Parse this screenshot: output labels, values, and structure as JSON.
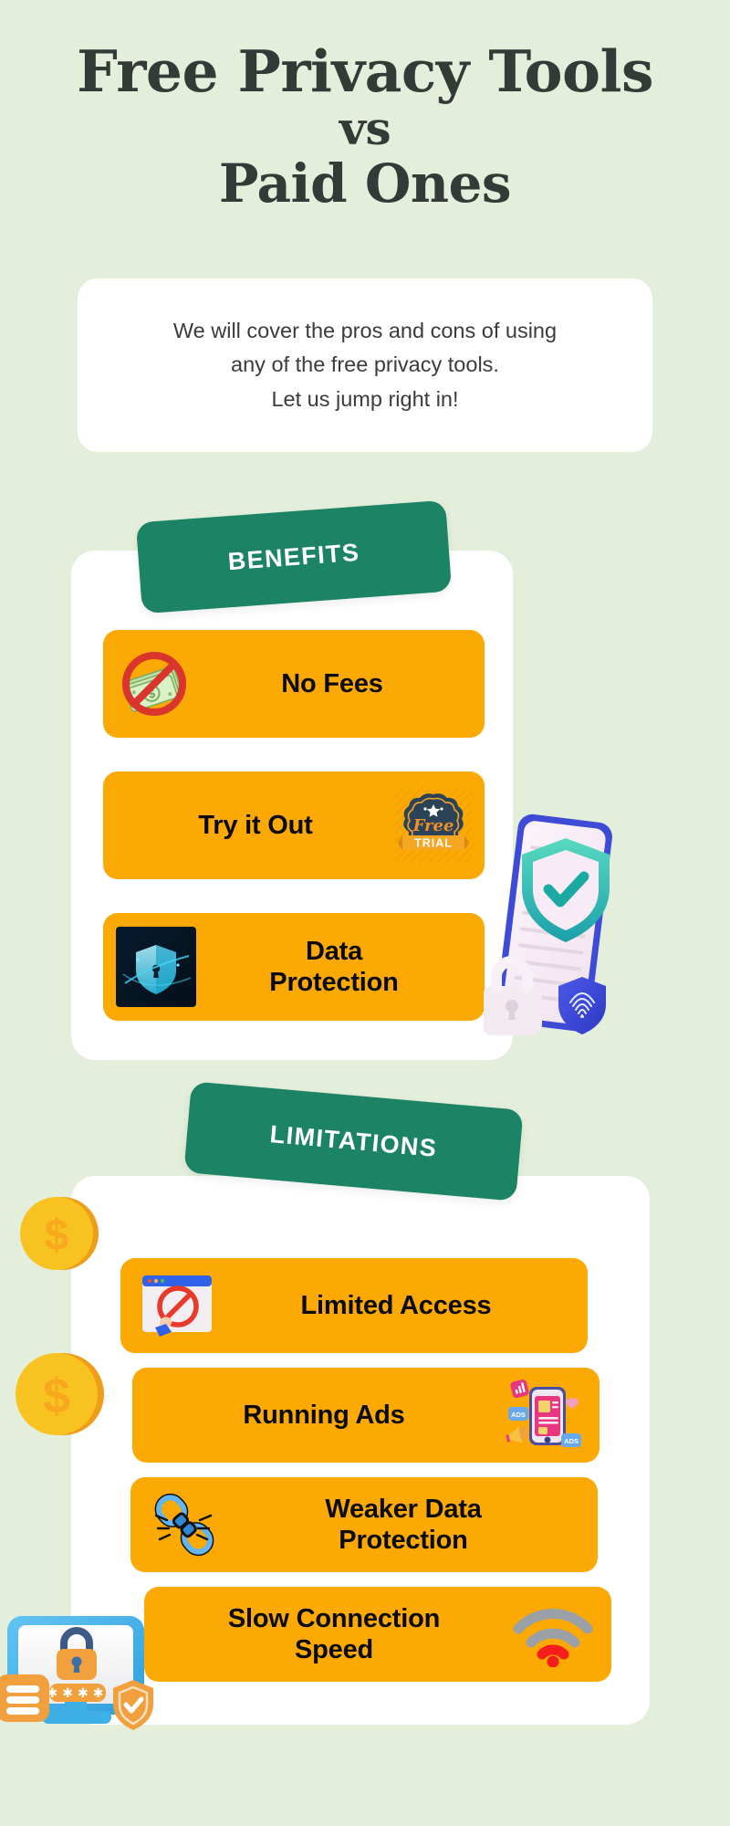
{
  "theme": {
    "background": "#e3eedb",
    "card": "#ffffff",
    "accent_green": "#1c8464",
    "accent_orange": "#fca903",
    "title_color": "#343a36",
    "body_text": "#3b3b3b",
    "row_text": "#0a0a0a",
    "coin_gold": "#f7c225",
    "coin_gold_dark": "#f29d18"
  },
  "title": {
    "line1": "Free Privacy Tools",
    "line2": "vs",
    "line3": "Paid Ones"
  },
  "intro": {
    "line1": "We will cover the pros and cons of using",
    "line2": "any of the free privacy tools.",
    "line3": "Let us jump right in!"
  },
  "sections": [
    {
      "badge_label": "BENEFITS",
      "items": [
        {
          "label": "No Fees",
          "icon": "no-money-icon",
          "icon_side": "left"
        },
        {
          "label": "Try it Out",
          "icon": "free-trial-badge-icon",
          "icon_side": "right"
        },
        {
          "label": "Data\nProtection",
          "label_line1": "Data",
          "label_line2": "Protection",
          "icon": "shield-keyhole-icon",
          "icon_side": "left"
        }
      ]
    },
    {
      "badge_label": "LIMITATIONS",
      "items": [
        {
          "label": "Limited Access",
          "icon": "browser-blocked-icon",
          "icon_side": "left"
        },
        {
          "label": "Running Ads",
          "icon": "phone-ads-icon",
          "icon_side": "right"
        },
        {
          "label_line1": "Weaker Data",
          "label_line2": "Protection",
          "icon": "broken-chain-icon",
          "icon_side": "left"
        },
        {
          "label_line1": "Slow Connection",
          "label_line2": "Speed",
          "icon": "weak-wifi-icon",
          "icon_side": "right"
        }
      ]
    }
  ],
  "decorations": [
    {
      "name": "dollar-coin",
      "symbol": "$"
    },
    {
      "name": "dollar-coin",
      "symbol": "$"
    },
    {
      "name": "document-shield-lock-fingerprint-illustration"
    },
    {
      "name": "monitor-password-security-illustration",
      "password_mask": "****"
    }
  ]
}
